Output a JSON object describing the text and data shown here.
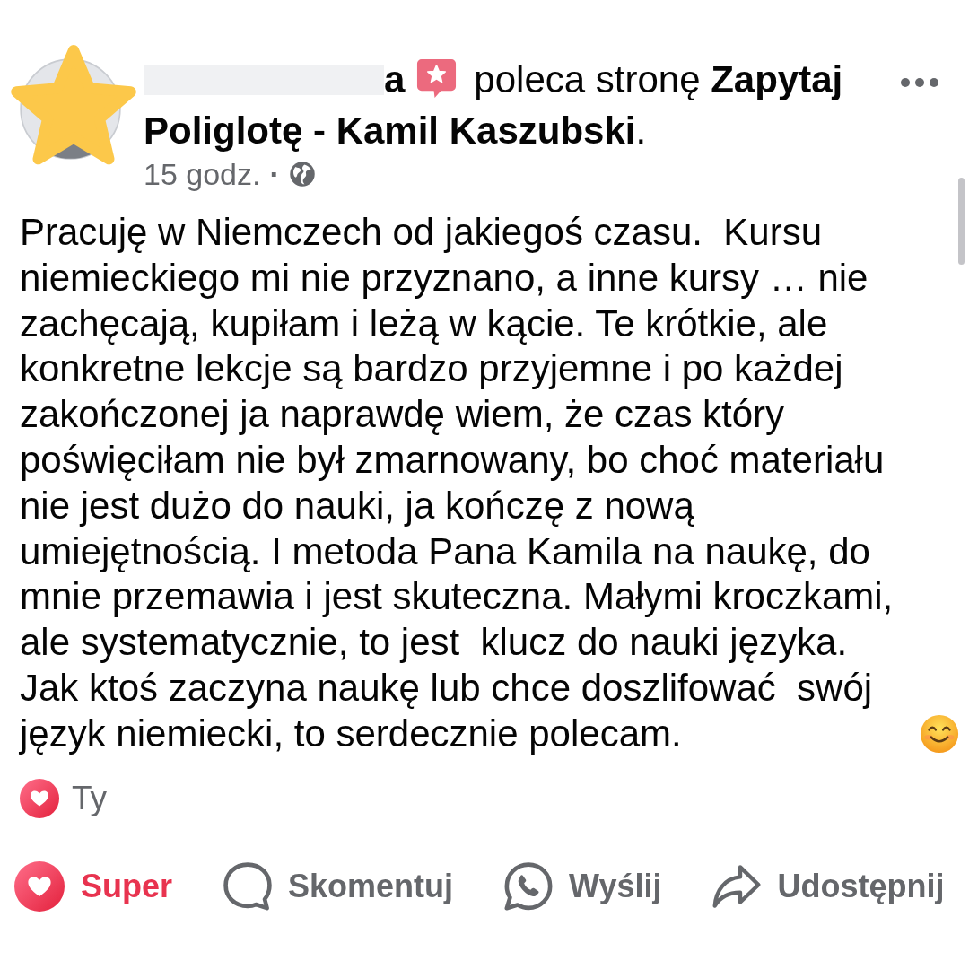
{
  "post": {
    "author": {
      "name": "a",
      "redacted": true
    },
    "action_text_lines": [
      "poleca stronę **Zapytaj**",
      "**Poliglotę - Kamil Kaszubski**."
    ],
    "time": "15 godz.",
    "separator": "·",
    "body": "Pracuję w Niemczech od jakiegoś czasu.  Kursu niemieckiego mi nie przyznano, a inne kursy … nie zachęcają, kupiłam i leżą w kącie. Te krótkie, ale konkretne lekcje są bardzo przyjemne i po każdej zakończonej ja naprawdę wiem, że czas który poświęciłam nie był zmarnowany, bo choć materiału nie jest dużo do nauki, ja kończę z nową umiejętnością. I metoda Pana Kamila na naukę, do mnie przemawia i jest skuteczna. Małymi kroczkami, ale systematycznie, to jest  klucz do nauki języka. Jak ktoś zaczyna naukę lub chce doszlifować  swój język niemiecki, to serdecznie polecam."
  },
  "reactions": {
    "label": "Ty"
  },
  "actions": [
    {
      "kind": "react",
      "label": "Super",
      "active": true
    },
    {
      "kind": "comment",
      "label": "Skomentuj",
      "active": false
    },
    {
      "kind": "send",
      "label": "Wyślij",
      "active": false
    },
    {
      "kind": "share",
      "label": "Udostępnij",
      "active": false
    }
  ]
}
